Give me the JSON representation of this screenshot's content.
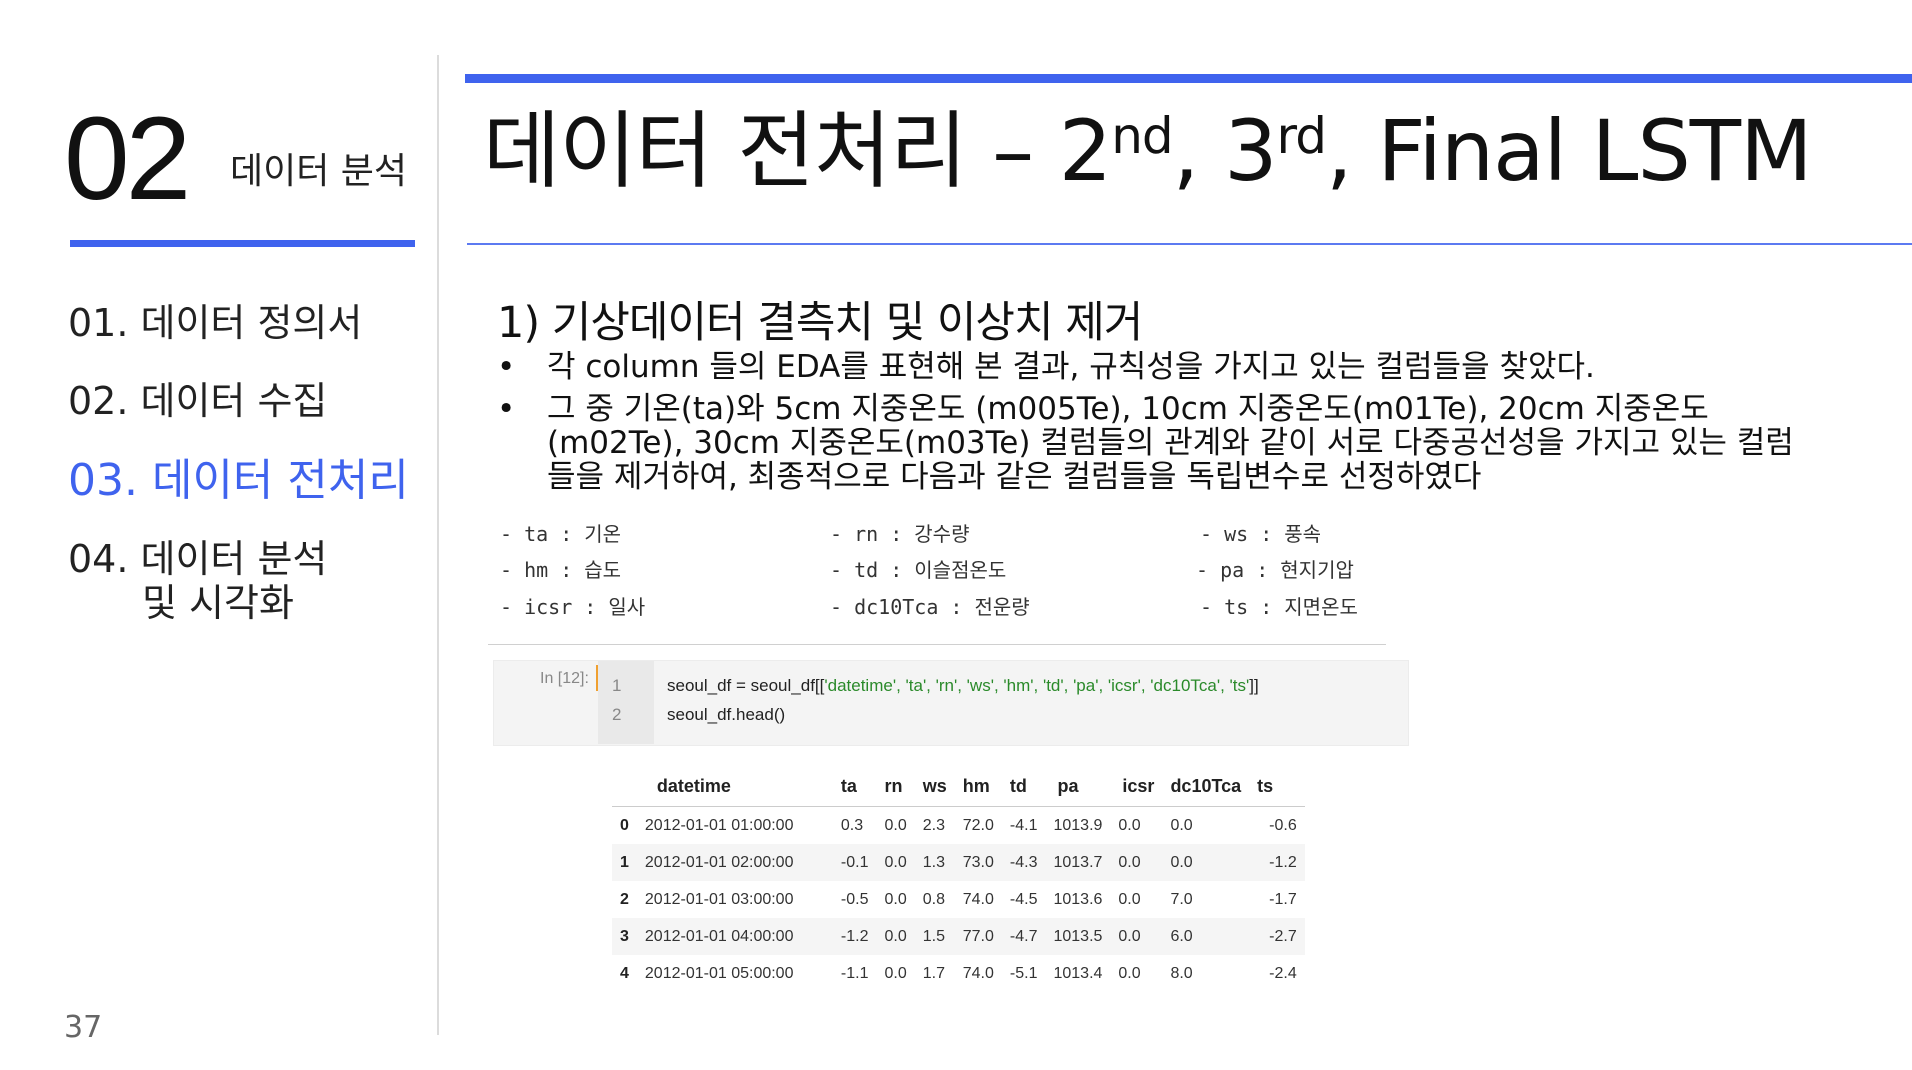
{
  "sidebar": {
    "section_number": "02",
    "section_title": "데이터 분석",
    "items": [
      {
        "label": "01. 데이터 정의서"
      },
      {
        "label": "02. 데이터 수집"
      },
      {
        "label": "03. 데이터 전처리"
      },
      {
        "label": "04. 데이터 분석",
        "sub": "및 시각화"
      }
    ],
    "page_number": "37",
    "accent_color": "#3f63ee"
  },
  "header": {
    "title_prefix": "데이터 전처리 – 2",
    "sup1": "nd",
    "mid": ", 3",
    "sup2": "rd",
    "title_suffix": ", Final LSTM"
  },
  "content": {
    "subheading": "1) 기상데이터 결측치 및 이상치 제거",
    "bullet_symbol": "•",
    "bullets": [
      "각 column 들의 EDA를 표현해 본 결과, 규칙성을 가지고 있는 컬럼들을 찾았다.",
      "그 중 기온(ta)와 5cm 지중온도 (m005Te), 10cm 지중온도(m01Te), 20cm 지중온도 (m02Te), 30cm 지중온도(m03Te) 컬럼들의 관계와 같이 서로 다중공선성을 가지고 있는 컬럼들을 제거하여, 최종적으로 다음과 같은 컬럼들을 독립변수로 선정하였다"
    ],
    "columns": [
      "- ta : 기온",
      "- rn : 강수량",
      "- ws : 풍속",
      "- hm : 습도",
      "- td : 이슬점온도",
      "- pa : 현지기압",
      "- icsr : 일사",
      "- dc10Tca : 전운량",
      "- ts : 지면온도"
    ]
  },
  "notebook": {
    "prompt": "In [12]:",
    "line1_no": "1",
    "line1_pre": "seoul_df = seoul_df[[",
    "line1_str": "'datetime', 'ta', 'rn', 'ws', 'hm', 'td', 'pa', 'icsr', 'dc10Tca', 'ts'",
    "line1_post": "]]",
    "line2_no": "2",
    "line2": "seoul_df.head()",
    "table": {
      "headers": [
        "",
        "datetime",
        "ta",
        "rn",
        "ws",
        "hm",
        "td",
        "pa",
        "icsr",
        "dc10Tca",
        "ts"
      ],
      "rows": [
        [
          "0",
          "2012-01-01 01:00:00",
          "0.3",
          "0.0",
          "2.3",
          "72.0",
          "-4.1",
          "1013.9",
          "0.0",
          "0.0",
          "-0.6"
        ],
        [
          "1",
          "2012-01-01 02:00:00",
          "-0.1",
          "0.0",
          "1.3",
          "73.0",
          "-4.3",
          "1013.7",
          "0.0",
          "0.0",
          "-1.2"
        ],
        [
          "2",
          "2012-01-01 03:00:00",
          "-0.5",
          "0.0",
          "0.8",
          "74.0",
          "-4.5",
          "1013.6",
          "0.0",
          "7.0",
          "-1.7"
        ],
        [
          "3",
          "2012-01-01 04:00:00",
          "-1.2",
          "0.0",
          "1.5",
          "77.0",
          "-4.7",
          "1013.5",
          "0.0",
          "6.0",
          "-2.7"
        ],
        [
          "4",
          "2012-01-01 05:00:00",
          "-1.1",
          "0.0",
          "1.7",
          "74.0",
          "-5.1",
          "1013.4",
          "0.0",
          "8.0",
          "-2.4"
        ]
      ]
    }
  }
}
